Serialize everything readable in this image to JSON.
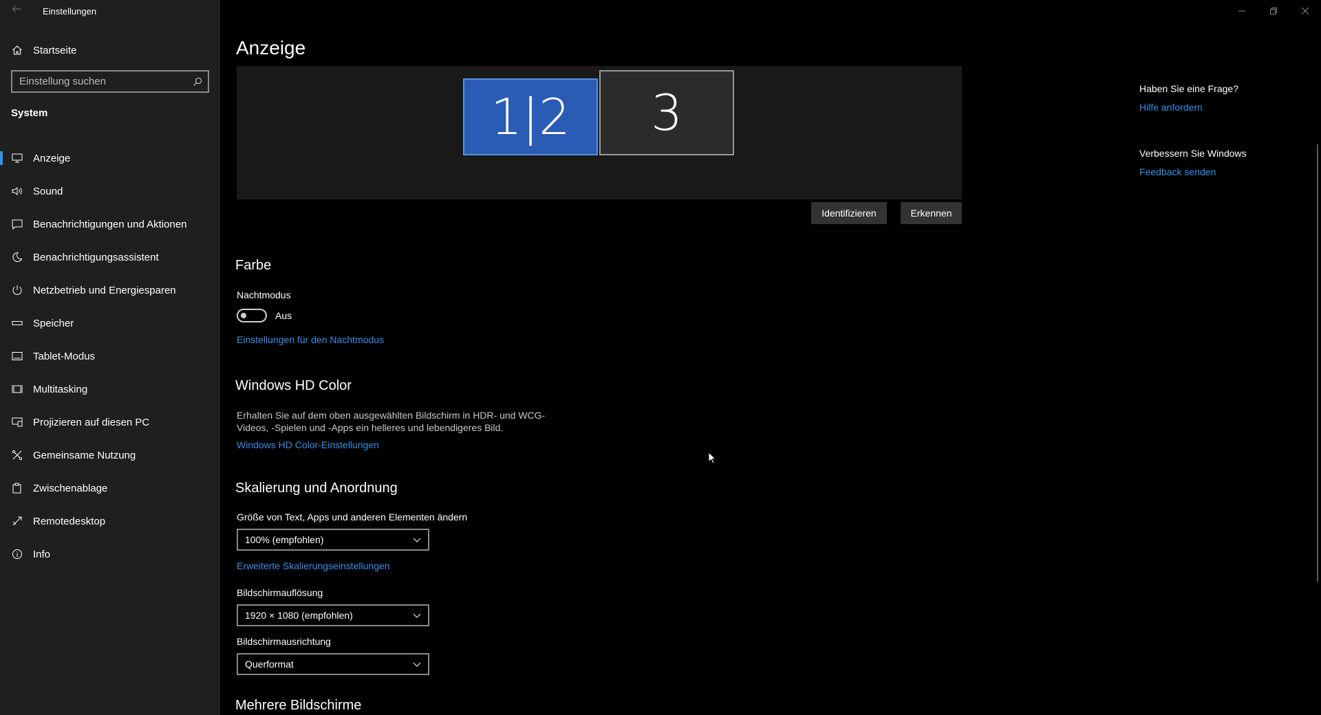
{
  "app": {
    "title": "Einstellungen"
  },
  "sidebar": {
    "home_label": "Startseite",
    "search_placeholder": "Einstellung suchen",
    "section": "System",
    "items": [
      {
        "label": "Anzeige",
        "icon": "monitor-icon",
        "active": true
      },
      {
        "label": "Sound",
        "icon": "speaker-icon"
      },
      {
        "label": "Benachrichtigungen und Aktionen",
        "icon": "notification-icon"
      },
      {
        "label": "Benachrichtigungsassistent",
        "icon": "moon-icon"
      },
      {
        "label": "Netzbetrieb und Energiesparen",
        "icon": "power-icon"
      },
      {
        "label": "Speicher",
        "icon": "storage-icon"
      },
      {
        "label": "Tablet-Modus",
        "icon": "tablet-icon"
      },
      {
        "label": "Multitasking",
        "icon": "multitasking-icon"
      },
      {
        "label": "Projizieren auf diesen PC",
        "icon": "project-icon"
      },
      {
        "label": "Gemeinsame Nutzung",
        "icon": "share-icon"
      },
      {
        "label": "Zwischenablage",
        "icon": "clipboard-icon"
      },
      {
        "label": "Remotedesktop",
        "icon": "remote-icon"
      },
      {
        "label": "Info",
        "icon": "info-icon"
      }
    ]
  },
  "main": {
    "title": "Anzeige",
    "monitors": {
      "primary": "1|2",
      "secondary": "3"
    },
    "buttons": {
      "identify": "Identifizieren",
      "detect": "Erkennen"
    },
    "color": {
      "heading": "Farbe",
      "night_mode_label": "Nachtmodus",
      "night_mode_state": "Aus",
      "night_mode_link": "Einstellungen für den Nachtmodus"
    },
    "hdr": {
      "heading": "Windows HD Color",
      "description": "Erhalten Sie auf dem oben ausgewählten Bildschirm in HDR- und WCG-Videos, -Spielen und -Apps ein helleres und lebendigeres Bild.",
      "link": "Windows HD Color-Einstellungen"
    },
    "scaling": {
      "heading": "Skalierung und Anordnung",
      "size_label": "Größe von Text, Apps und anderen Elementen ändern",
      "size_value": "100% (empfohlen)",
      "advanced_link": "Erweiterte Skalierungseinstellungen",
      "resolution_label": "Bildschirmauflösung",
      "resolution_value": "1920 × 1080 (empfohlen)",
      "orientation_label": "Bildschirmausrichtung",
      "orientation_value": "Querformat"
    },
    "multi": {
      "heading": "Mehrere Bildschirme"
    }
  },
  "side_panel": {
    "question_heading": "Haben Sie eine Frage?",
    "help_link": "Hilfe anfordern",
    "improve_heading": "Verbessern Sie Windows",
    "feedback_link": "Feedback senden"
  },
  "colors": {
    "accent": "#3a8fe8",
    "primary_monitor": "#2a5bb5",
    "sidebar_bg": "#1f1f1f"
  }
}
